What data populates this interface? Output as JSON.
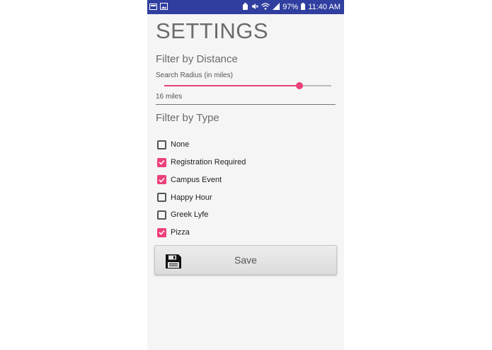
{
  "status_bar": {
    "battery": "97%",
    "time": "11:40 AM",
    "icons": [
      "notification-icon",
      "image-icon",
      "alarm-icon",
      "mute-icon",
      "wifi-icon",
      "signal-icon",
      "battery-icon"
    ]
  },
  "page": {
    "title": "SETTINGS"
  },
  "distance": {
    "heading": "Filter by Distance",
    "slider_label": "Search Radius (in miles)",
    "slider_value_fraction": 0.81,
    "miles_text": "16 miles"
  },
  "type_filter": {
    "heading": "Filter by Type",
    "options": [
      {
        "label": "None",
        "checked": false
      },
      {
        "label": "Registration Required",
        "checked": true
      },
      {
        "label": "Campus Event",
        "checked": true
      },
      {
        "label": "Happy Hour",
        "checked": false
      },
      {
        "label": "Greek Lyfe",
        "checked": false
      },
      {
        "label": "Pizza",
        "checked": true
      }
    ]
  },
  "save_button": {
    "label": "Save",
    "icon": "floppy-disk-icon"
  },
  "colors": {
    "status_bar": "#303f9f",
    "accent": "#ec407a",
    "background": "#f5f5f5"
  }
}
